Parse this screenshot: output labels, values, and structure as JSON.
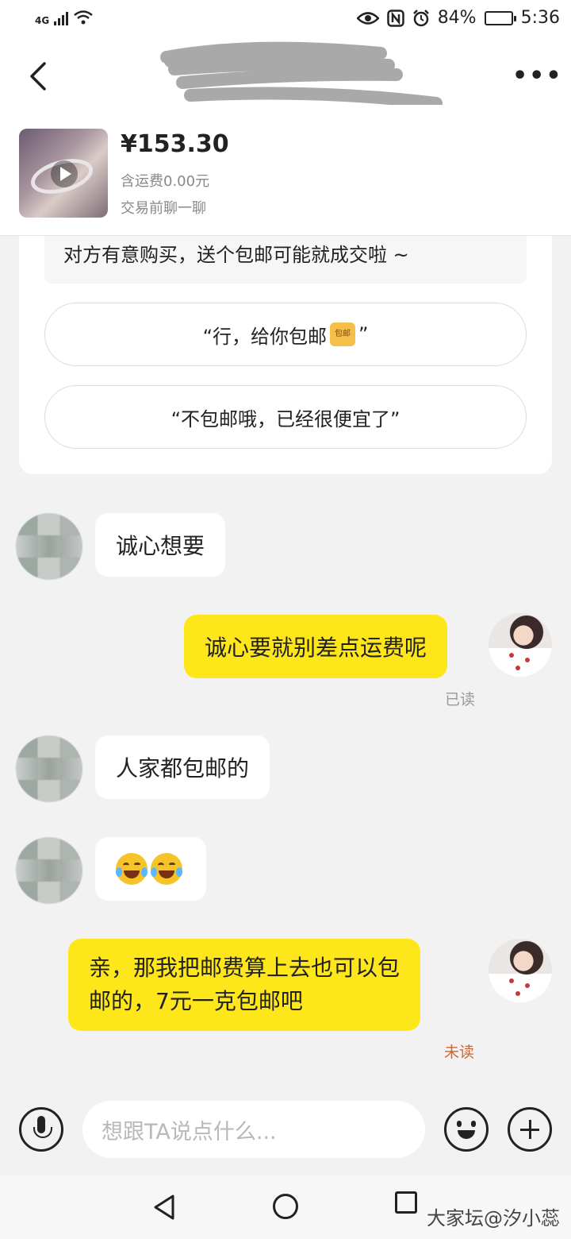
{
  "status_bar": {
    "network": "4G",
    "battery": "84%",
    "time": "5:36",
    "battery_level": 0.84
  },
  "header": {
    "back_icon": "chevron-left-icon",
    "more_icon": "more-dots-icon",
    "more_label": "•••"
  },
  "product": {
    "price": "¥153.30",
    "shipping": "含运费0.00元",
    "hint": "交易前聊一聊"
  },
  "suggestion_card": {
    "tip": "对方有意购买，送个包邮可能就成交啦 ~",
    "option_1_prefix": "“行，给你包邮",
    "option_1_badge": "包邮",
    "option_1_suffix": "”",
    "option_2": "“不包邮哦，已经很便宜了”"
  },
  "messages": {
    "m1": "诚心想要",
    "m2": "诚心要就别差点运费呢",
    "m2_status": "已读",
    "m3": "人家都包邮的",
    "m5_line1": "亲，那我把邮费算上去也可以包",
    "m5_line2": "邮的，7元一克包邮吧",
    "m5_status": "未读"
  },
  "input_bar": {
    "placeholder": "想跟TA说点什么..."
  },
  "nav": {
    "watermark": "大家坛@汐小蕊"
  },
  "colors": {
    "accent_yellow": "#fde619",
    "unread": "#d9622b"
  }
}
